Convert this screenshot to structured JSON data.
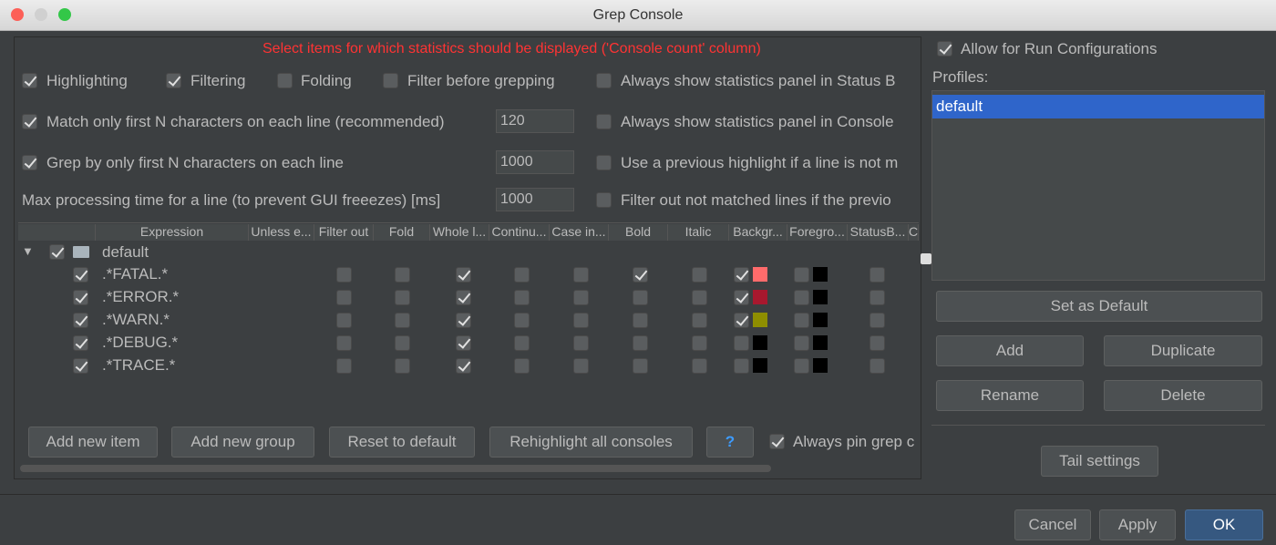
{
  "window": {
    "title": "Grep Console"
  },
  "notice": "Select items for which statistics should be displayed ('Console count' column)",
  "options": {
    "highlighting": {
      "label": "Highlighting",
      "checked": true
    },
    "filtering": {
      "label": "Filtering",
      "checked": true
    },
    "folding": {
      "label": "Folding",
      "checked": false
    },
    "filter_before": {
      "label": "Filter before grepping",
      "checked": false
    },
    "always_status": {
      "label": "Always show statistics panel in Status B",
      "checked": false
    },
    "match_first": {
      "label": "Match only first N characters on each line (recommended)",
      "checked": true,
      "value": "120"
    },
    "always_console": {
      "label": "Always show statistics panel in Console",
      "checked": false
    },
    "grep_first": {
      "label": "Grep by only first N characters on each line",
      "checked": true,
      "value": "1000"
    },
    "use_prev": {
      "label": "Use a previous highlight if a line is not m",
      "checked": false
    },
    "max_time": {
      "label": "Max processing time for a line (to prevent GUI freeezes) [ms]",
      "value": "1000"
    },
    "filter_out": {
      "label": "Filter out not matched lines if the previo",
      "checked": false
    }
  },
  "table": {
    "headers": [
      "",
      "Expression",
      "Unless e...",
      "Filter out",
      "Fold",
      "Whole l...",
      "Continu...",
      "Case in...",
      "Bold",
      "Italic",
      "Backgr...",
      "Foregro...",
      "StatusB...",
      "C"
    ],
    "group": {
      "name": "default",
      "checked": true
    },
    "rows": [
      {
        "expr": ".*FATAL.*",
        "on": true,
        "filter": false,
        "fold": false,
        "whole": true,
        "cont": false,
        "case": false,
        "bold": true,
        "italic": false,
        "bg_on": true,
        "bg": "#ff6b6b",
        "fg_on": false,
        "fg": "#000000",
        "status": false
      },
      {
        "expr": ".*ERROR.*",
        "on": true,
        "filter": false,
        "fold": false,
        "whole": true,
        "cont": false,
        "case": false,
        "bold": false,
        "italic": false,
        "bg_on": true,
        "bg": "#a8182e",
        "fg_on": false,
        "fg": "#000000",
        "status": false
      },
      {
        "expr": ".*WARN.*",
        "on": true,
        "filter": false,
        "fold": false,
        "whole": true,
        "cont": false,
        "case": false,
        "bold": false,
        "italic": false,
        "bg_on": true,
        "bg": "#8e8e00",
        "fg_on": false,
        "fg": "#000000",
        "status": false
      },
      {
        "expr": ".*DEBUG.*",
        "on": true,
        "filter": false,
        "fold": false,
        "whole": true,
        "cont": false,
        "case": false,
        "bold": false,
        "italic": false,
        "bg_on": false,
        "bg": "#000000",
        "fg_on": false,
        "fg": "#000000",
        "status": false
      },
      {
        "expr": ".*TRACE.*",
        "on": true,
        "filter": false,
        "fold": false,
        "whole": true,
        "cont": false,
        "case": false,
        "bold": false,
        "italic": false,
        "bg_on": false,
        "bg": "#000000",
        "fg_on": false,
        "fg": "#000000",
        "status": false
      }
    ]
  },
  "buttons": {
    "add_item": "Add new item",
    "add_group": "Add new group",
    "reset": "Reset to default",
    "rehighlight": "Rehighlight all consoles",
    "help": "?",
    "always_pin": "Always pin grep c"
  },
  "right": {
    "allow_run": "Allow for Run Configurations",
    "profiles_label": "Profiles:",
    "profiles": [
      "default"
    ],
    "set_default": "Set as Default",
    "add": "Add",
    "duplicate": "Duplicate",
    "rename": "Rename",
    "delete": "Delete",
    "tail": "Tail settings"
  },
  "footer": {
    "cancel": "Cancel",
    "apply": "Apply",
    "ok": "OK"
  }
}
